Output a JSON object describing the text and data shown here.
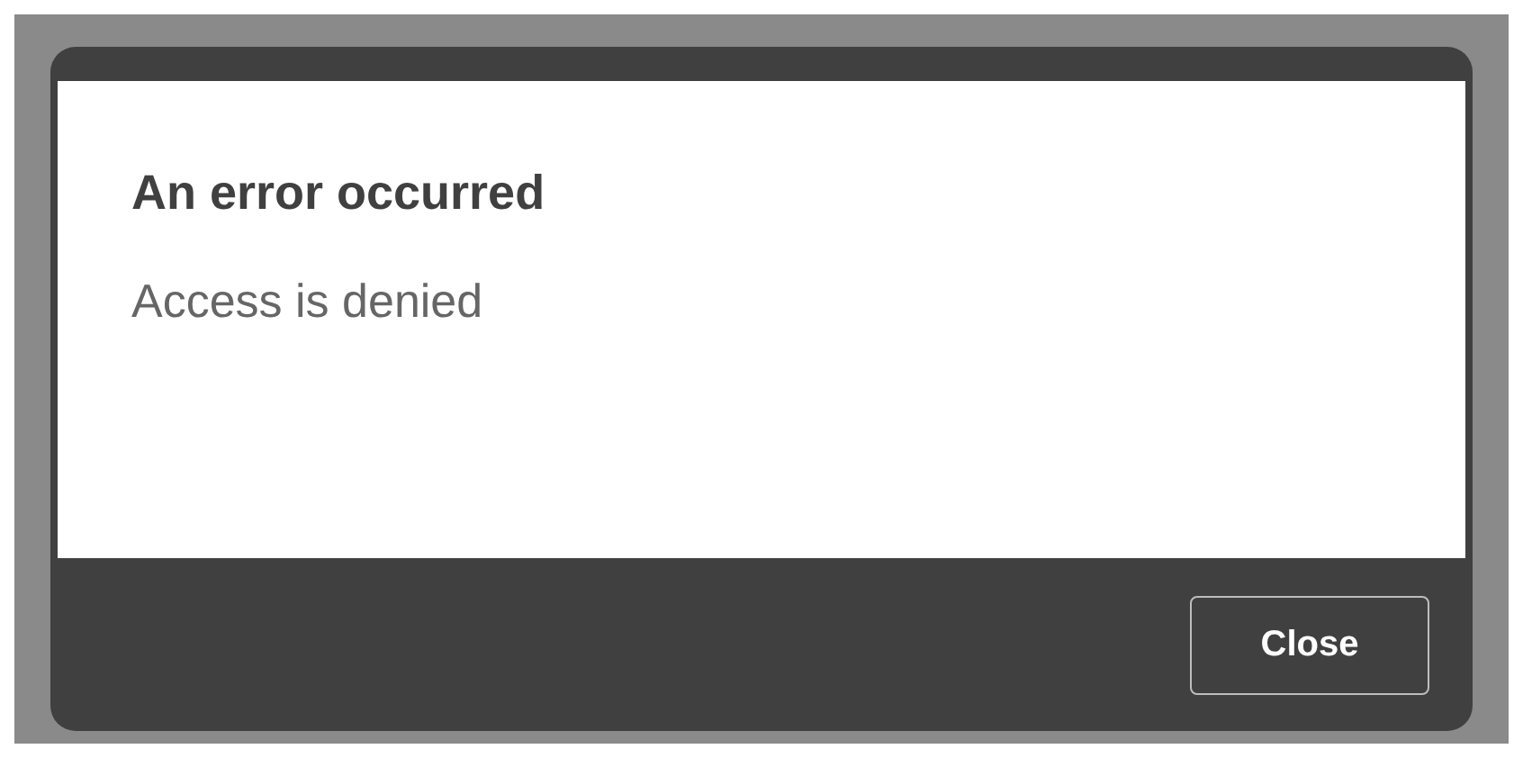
{
  "dialog": {
    "title": "An error occurred",
    "message": "Access is denied",
    "buttons": [
      "Close"
    ]
  }
}
